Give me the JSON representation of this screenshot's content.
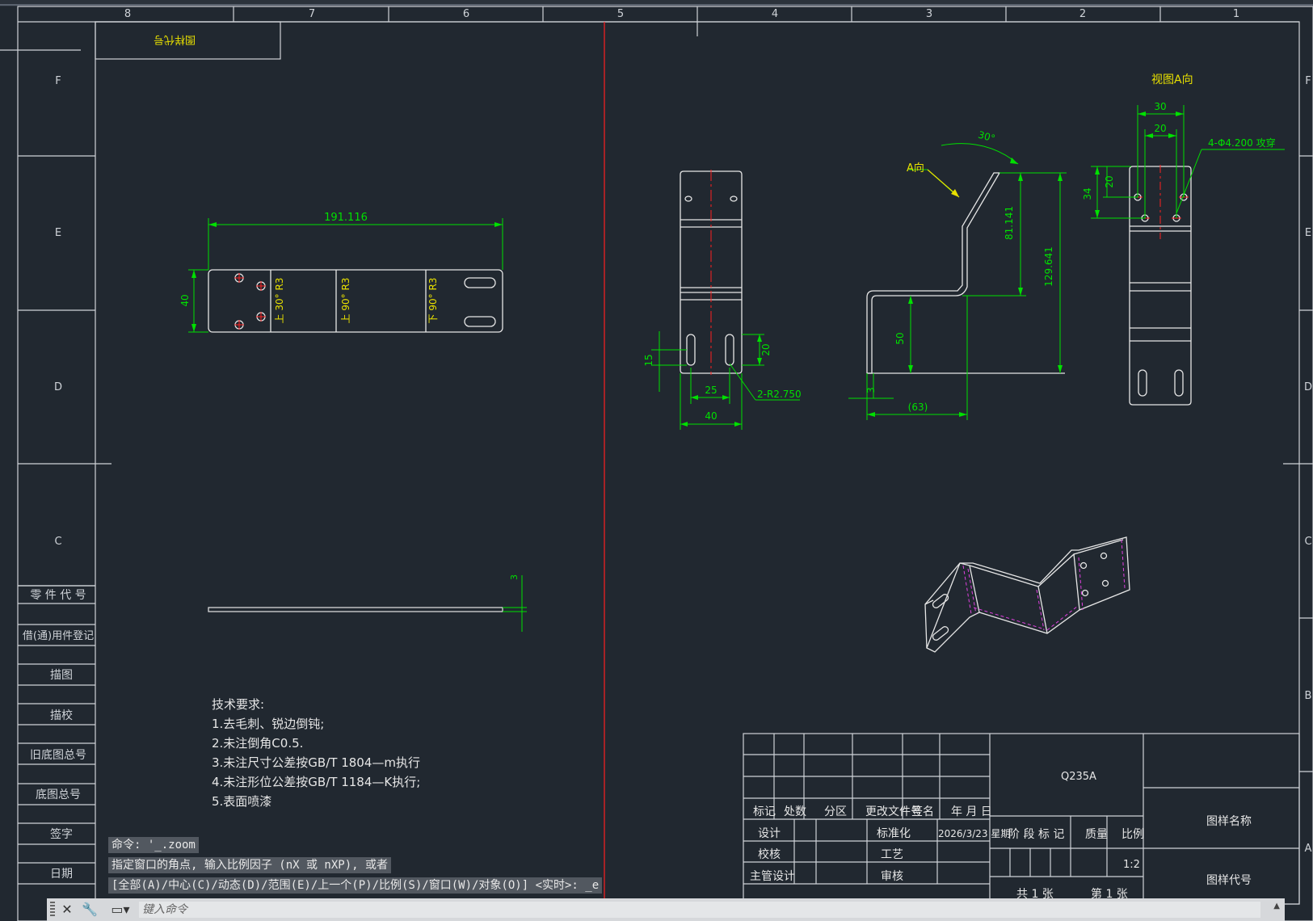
{
  "zone_cols": [
    "8",
    "7",
    "6",
    "5",
    "4",
    "3",
    "2",
    "1"
  ],
  "zone_rows": [
    "F",
    "E",
    "D",
    "C",
    "B",
    "A"
  ],
  "revision_box_label": "图样代号",
  "left_strip": {
    "part_code": "零 件 代 号",
    "borrow_record": "借(通)用件登记",
    "trace": "描图",
    "trace_check": "描校",
    "old_base_no": "旧底图总号",
    "base_no": "底图总号",
    "signature": "签字",
    "date": "日期"
  },
  "drawing": {
    "view_a_title": "视图A向",
    "view_a_arrow": "A向",
    "dims": {
      "flat_length": "191.116",
      "flat_height": "40",
      "bend1": "上 30° R3",
      "bend2": "上 90° R3",
      "bend3": "下 90° R3",
      "thickness": "3",
      "front_15": "15",
      "front_20": "20",
      "front_25": "25",
      "front_40": "40",
      "slot": "2-R2.750",
      "angle": "30°",
      "side_81": "81.141",
      "side_129": "129.641",
      "side_50": "50",
      "side_3": "3",
      "side_63": "(63)",
      "va_30": "30",
      "va_20": "20",
      "va_34": "34",
      "va_20b": "20",
      "holes": "4-Φ4.200 攻穿"
    }
  },
  "tech_requirements": {
    "title": "技术要求:",
    "items": [
      "1.去毛刺、锐边倒钝;",
      "2.未注倒角C0.5.",
      "3.未注尺寸公差按GB/T 1804—m执行",
      "4.未注形位公差按GB/T 1184—K执行;",
      "5.表面喷漆"
    ]
  },
  "title_block": {
    "material": "Q235A",
    "part_name_label": "图样名称",
    "part_code_label": "图样代号",
    "col_mark": "标记",
    "col_count": "处数",
    "col_zone": "分区",
    "col_change_doc": "更改文件号",
    "col_sign": "签名",
    "col_date": "年 月 日",
    "design": "设计",
    "standardize": "标准化",
    "design_date": "2026/3/23 星期",
    "stage_mark": "阶 段 标 记",
    "mass": "质量",
    "scale_label": "比例",
    "scale_value": "1:2",
    "check": "校核",
    "process": "工艺",
    "chief_design": "主管设计",
    "review": "审核",
    "total_sheets": "共 1 张",
    "sheet_no": "第 1 张"
  },
  "command": {
    "history": [
      "命令: '_.zoom",
      "指定窗口的角点, 输入比例因子 (nX 或 nXP), 或者",
      "[全部(A)/中心(C)/动态(D)/范围(E)/上一个(P)/比例(S)/窗口(W)/对象(O)] <实时>: _e"
    ],
    "placeholder": "键入命令"
  },
  "colors": {
    "background": "#212830",
    "frame": "#d8d8d8",
    "dimension": "#00e000",
    "text_yellow": "#e8e000",
    "center_red": "#ff2020",
    "hidden_magenta": "#e040e0"
  }
}
